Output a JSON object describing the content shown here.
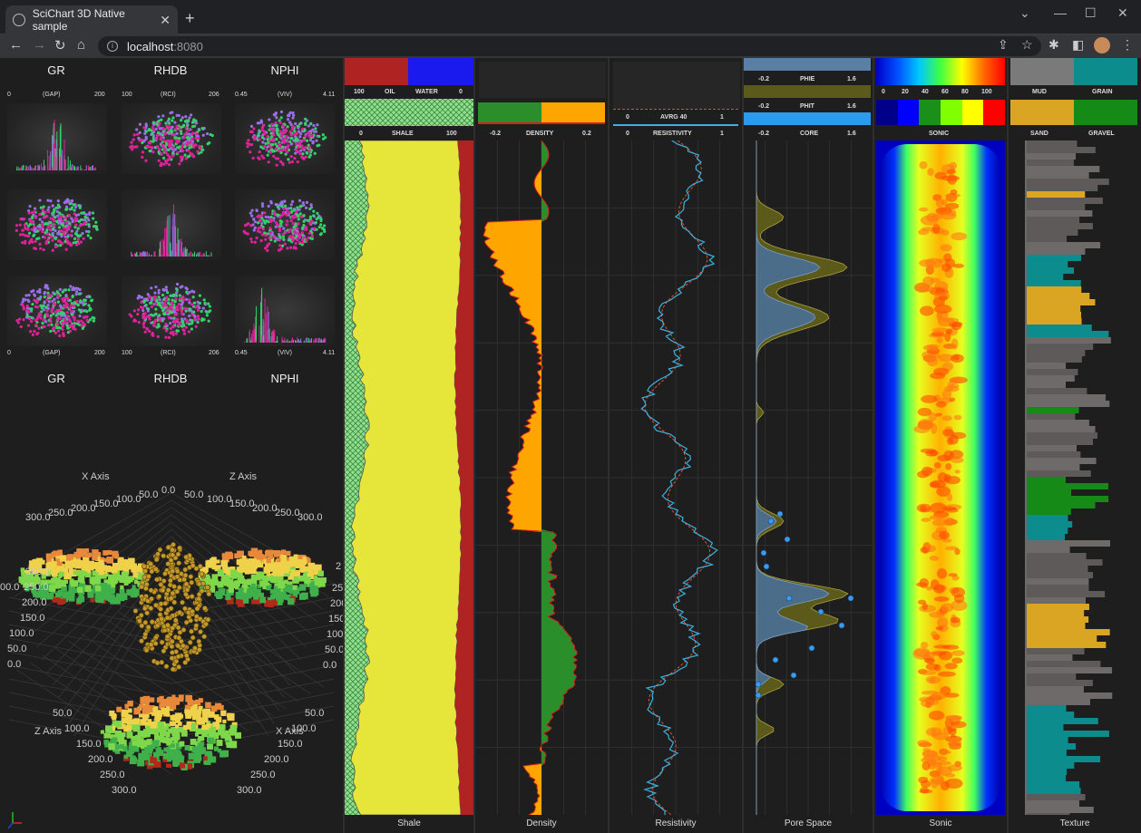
{
  "browser": {
    "tab_title": "SciChart 3D Native sample",
    "tab_close": "✕",
    "new_tab": "+",
    "url_host": "localhost",
    "url_port": ":8080",
    "info_glyph": "i"
  },
  "matrix": {
    "top_headers": [
      "GR",
      "RHDB",
      "NPHI"
    ],
    "bottom_headers": [
      "GR",
      "RHDB",
      "NPHI"
    ],
    "top_axes": [
      {
        "min": "0",
        "mid": "(GAP)",
        "max": "200"
      },
      {
        "min": "100",
        "mid": "(RCI)",
        "max": "206"
      },
      {
        "min": "0.45",
        "mid": "(VIV)",
        "max": "4.11"
      }
    ],
    "bottom_axes": [
      {
        "min": "0",
        "mid": "(GAP)",
        "max": "200"
      },
      {
        "min": "100",
        "mid": "(RCI)",
        "max": "206"
      },
      {
        "min": "0.45",
        "mid": "(VIV)",
        "max": "4.11"
      }
    ],
    "colors": {
      "magenta": "#e0219a",
      "green": "#31d36a",
      "purple": "#9a6ee6"
    }
  },
  "chart3d": {
    "x_axis": "X Axis",
    "z_axis_top": "Z Axis",
    "z_axis_bottom": "Z Axis",
    "x_axis_bottom": "X Axis",
    "top_ticks": [
      "300.0",
      "250.0",
      "200.0",
      "150.0",
      "100.0",
      "50.0",
      "0.0",
      "50.0",
      "100.0",
      "150.0",
      "200.0",
      "250.0",
      "300.0"
    ],
    "left_ticks": [
      "300.0",
      "250.0",
      "200.0",
      "150.0",
      "100.0",
      "50.0",
      "0.0"
    ],
    "right_ticks": [
      "250",
      "200",
      "150",
      "100.",
      "50.0",
      "0.0"
    ],
    "bottom_left_ticks": [
      "50.0",
      "100.0",
      "150.0",
      "200.0",
      "250.0",
      "300.0"
    ],
    "bottom_right_ticks": [
      "50.0",
      "100.0",
      "150.0",
      "200.0",
      "250.0",
      "300.0"
    ],
    "left_cut_tick": "00.0",
    "right_cut_tick": "2"
  },
  "tracks": {
    "shale": {
      "footer": "Shale",
      "oil_label": "OIL",
      "water_label": "WATER",
      "oil_min": "100",
      "water_max": "0",
      "shale_label": "SHALE",
      "shale_min": "0",
      "shale_max": "100",
      "colors": {
        "oil": "#b02323",
        "water": "#1a1aee",
        "shale": "#e6e63a",
        "hatch": "#7fd27f"
      }
    },
    "density": {
      "footer": "Density",
      "label": "DENSITY",
      "min": "-0.2",
      "max": "0.2",
      "colors": {
        "green": "#2a8f2a",
        "orange": "#ffa500",
        "line": "#d42020"
      }
    },
    "resistivity": {
      "footer": "Resistivity",
      "avg_label": "AVRG 40",
      "avg_min": "0",
      "avg_max": "1",
      "label": "RESISTIVITY",
      "min": "0",
      "max": "1",
      "colors": {
        "line": "#3fb0e0",
        "avg": "#e05030"
      }
    },
    "pore": {
      "footer": "Pore Space",
      "phie_label": "PHIE",
      "phie_min": "-0.2",
      "phie_max": "1.6",
      "phit_label": "PHIT",
      "phit_min": "-0.2",
      "phit_max": "1.6",
      "core_label": "CORE",
      "core_min": "-0.2",
      "core_max": "1.6"
    },
    "sonic": {
      "footer": "Sonic",
      "label": "SONIC",
      "ticks": [
        "0",
        "20",
        "40",
        "60",
        "80",
        "100"
      ]
    },
    "texture": {
      "footer": "Texture",
      "mud": "MUD",
      "grain": "GRAIN",
      "sand": "SAND",
      "gravel": "GRAVEL",
      "colors": {
        "mud": "#7a7a7a",
        "grain": "#0c8c8c",
        "sand": "#d9a522",
        "gravel": "#168a16"
      }
    }
  }
}
